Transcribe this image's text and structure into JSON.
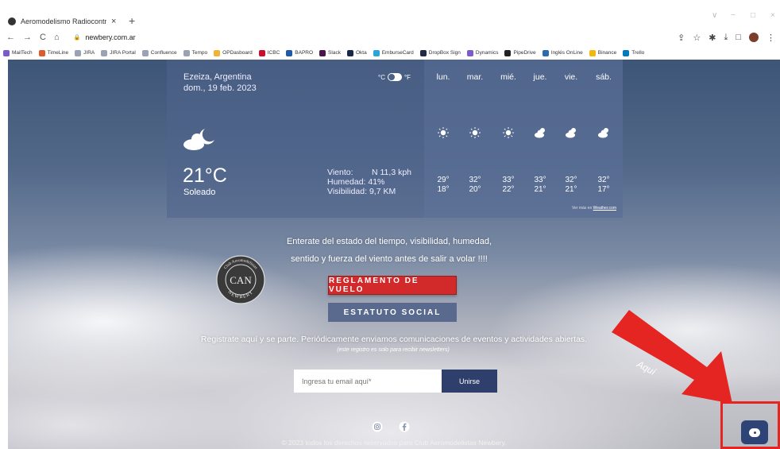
{
  "browser": {
    "tab_title": "Aeromodelismo Radiocontrolado",
    "tab_close": "×",
    "new_tab": "+",
    "nav": {
      "back": "←",
      "forward": "→",
      "reload": "C",
      "home": "⌂"
    },
    "url": "newbery.com.ar",
    "lock": "🔒",
    "toolbar_icons": [
      "⇪",
      "☆",
      "✱",
      "⤓",
      "□",
      "⋮"
    ],
    "window_controls": [
      "∨",
      "−",
      "□",
      "×"
    ],
    "bookmarks": [
      {
        "label": "MailTech",
        "color": "#7b5cc4"
      },
      {
        "label": "TimeLine",
        "color": "#e05a2b"
      },
      {
        "label": "JIRA",
        "color": "#9aa3b5"
      },
      {
        "label": "JIRA Portal",
        "color": "#9aa3b5"
      },
      {
        "label": "Confluence",
        "color": "#9aa3b5"
      },
      {
        "label": "Tempo",
        "color": "#9aa3b5"
      },
      {
        "label": "OPDasboard",
        "color": "#f2b233"
      },
      {
        "label": "ICBC",
        "color": "#c8102e"
      },
      {
        "label": "BAPRO",
        "color": "#1f5aa6"
      },
      {
        "label": "Slack",
        "color": "#4a154b"
      },
      {
        "label": "Okta",
        "color": "#17284a"
      },
      {
        "label": "EmburseCard",
        "color": "#2aa6d6"
      },
      {
        "label": "DropBox Sign",
        "color": "#1f2a44"
      },
      {
        "label": "Dynamics",
        "color": "#7a5ccf"
      },
      {
        "label": "PipeDrive",
        "color": "#222222"
      },
      {
        "label": "Inglés OnLine",
        "color": "#2b6cb0"
      },
      {
        "label": "Binance",
        "color": "#f0b90b"
      },
      {
        "label": "Trello",
        "color": "#0079bf"
      }
    ]
  },
  "weather": {
    "location": "Ezeiza, Argentina",
    "date": "dom., 19 feb. 2023",
    "unit_c": "°C",
    "unit_f": "°F",
    "temperature": "21°C",
    "condition": "Soleado",
    "wind_label": "Viento:",
    "wind_value": "N 11,3 kph",
    "humidity_label": "Humedad:",
    "humidity_value": "41%",
    "visibility_label": "Visibilidad:",
    "visibility_value": "9,7 KM",
    "more_label": "Ver más en",
    "more_link": "Weather.com",
    "forecast": [
      {
        "day": "lun.",
        "hi": "29°",
        "lo": "18°",
        "icon": "sun"
      },
      {
        "day": "mar.",
        "hi": "32°",
        "lo": "20°",
        "icon": "sun"
      },
      {
        "day": "mié.",
        "hi": "33°",
        "lo": "22°",
        "icon": "sun"
      },
      {
        "day": "jue.",
        "hi": "33°",
        "lo": "21°",
        "icon": "cloud"
      },
      {
        "day": "vie.",
        "hi": "32°",
        "lo": "21°",
        "icon": "cloud"
      },
      {
        "day": "sáb.",
        "hi": "32°",
        "lo": "17°",
        "icon": "cloud"
      }
    ]
  },
  "intro": {
    "line1": "Enterate del estado del tiempo, visibilidad, humedad,",
    "line2": "sentido y fuerza del viento antes de salir a volar !!!!"
  },
  "logo": {
    "top_text": "Club Aeromodelistas",
    "bottom_text": "NEWBERY",
    "monogram": "CAN"
  },
  "buttons": {
    "reglamento": "REGLAMENTO DE VUELO",
    "estatuto": "ESTATUTO SOCIAL",
    "unirse": "Unirse"
  },
  "register": {
    "text": "Registrate aquí y se parte. Periódicamente enviamos comunicaciones de eventos y actividades abiertas.",
    "note": "(este registro es solo para recibir newsletters)",
    "email_placeholder": "Ingresa tu email aquí*"
  },
  "footer": "© 2023 todos los derechos reservados para Club Aeromodelistas Newbery.",
  "annotation": {
    "label": "Aquí",
    "color": "#e52521"
  }
}
